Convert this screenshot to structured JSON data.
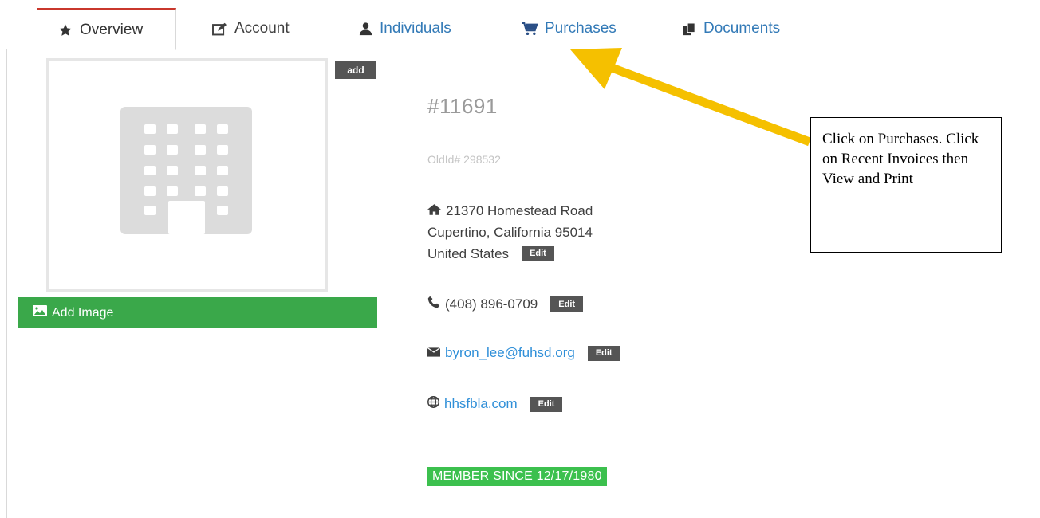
{
  "tabs": [
    {
      "label": "Overview",
      "icon": "star-icon"
    },
    {
      "label": "Account",
      "icon": "edit-icon"
    },
    {
      "label": "Individuals",
      "icon": "user-icon"
    },
    {
      "label": "Purchases",
      "icon": "cart-icon"
    },
    {
      "label": "Documents",
      "icon": "documents-icon"
    }
  ],
  "image": {
    "add_label": "add",
    "add_image_label": "Add Image",
    "placeholder_icon": "building-icon"
  },
  "account": {
    "number": "#11691",
    "old_id": "OldId# 298532"
  },
  "address": {
    "line1": "21370 Homestead Road",
    "line2": "Cupertino, California 95014",
    "line3": "United States"
  },
  "phone": "(408) 896-0709",
  "email": "byron_lee@fuhsd.org",
  "website": "hhsfbla.com",
  "edit_label": "Edit",
  "member_since": "MEMBER SINCE 12/17/1980",
  "callout": {
    "text": "Click on Purchases. Click on Recent Invoices then View and Print"
  },
  "colors": {
    "active_tab_top": "#c9372c",
    "link": "#337ab7",
    "green": "#3aa84a",
    "member_green": "#3cc04e",
    "arrow": "#f5c000"
  }
}
